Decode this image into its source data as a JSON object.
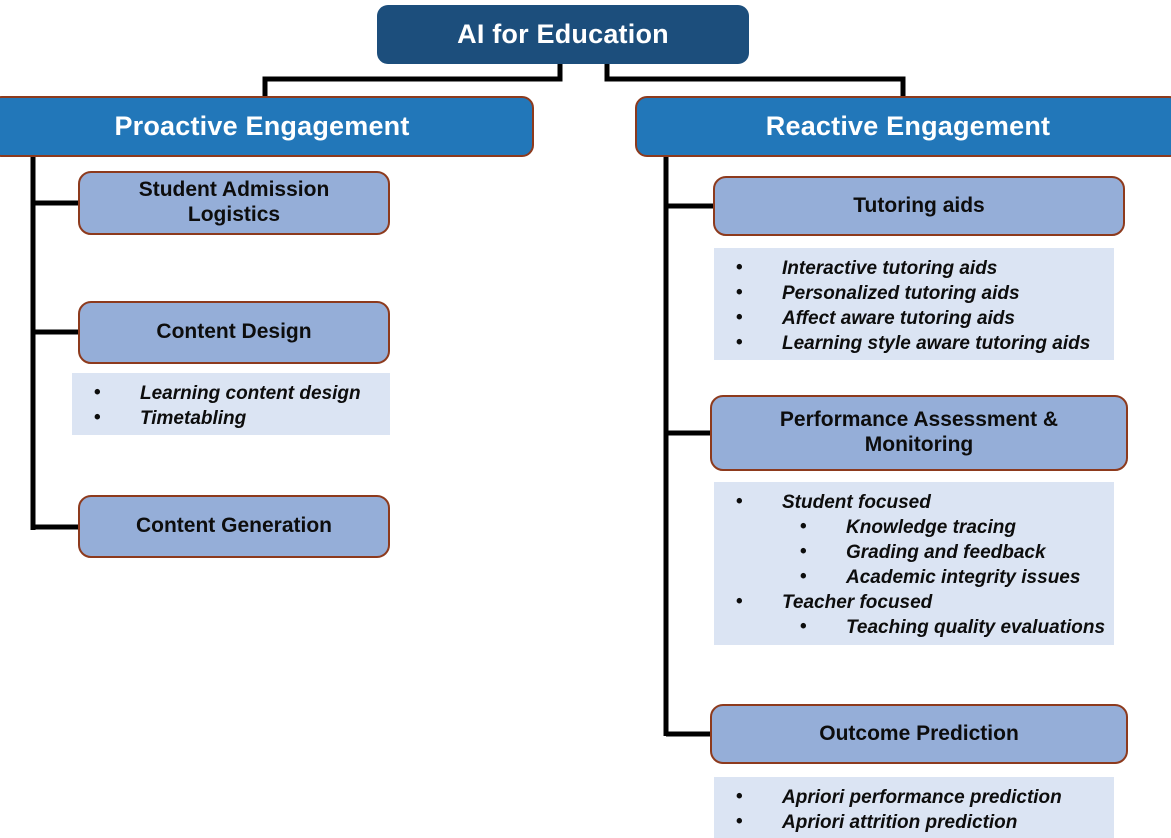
{
  "diagram": {
    "title": "AI for Education",
    "root": {
      "label": "AI for Education"
    },
    "branches": [
      {
        "id": "proactive",
        "label": "Proactive Engagement",
        "children": [
          {
            "id": "admission",
            "label": "Student Admission Logistics",
            "label_line1": "Student Admission",
            "label_line2": "Logistics",
            "bullets": []
          },
          {
            "id": "design",
            "label": "Content Design",
            "bullets": [
              {
                "level": 1,
                "text": "Learning content design"
              },
              {
                "level": 1,
                "text": "Timetabling"
              }
            ]
          },
          {
            "id": "generation",
            "label": "Content Generation",
            "bullets": []
          }
        ]
      },
      {
        "id": "reactive",
        "label": "Reactive Engagement",
        "children": [
          {
            "id": "tutoring",
            "label": "Tutoring aids",
            "bullets": [
              {
                "level": 1,
                "text": "Interactive tutoring aids"
              },
              {
                "level": 1,
                "text": "Personalized tutoring aids"
              },
              {
                "level": 1,
                "text": "Affect aware tutoring aids"
              },
              {
                "level": 1,
                "text": "Learning style aware tutoring aids"
              }
            ]
          },
          {
            "id": "performance",
            "label": "Performance Assessment & Monitoring",
            "label_line1": "Performance Assessment &",
            "label_line2": "Monitoring",
            "bullets": [
              {
                "level": 1,
                "text": "Student focused"
              },
              {
                "level": 2,
                "text": "Knowledge tracing"
              },
              {
                "level": 2,
                "text": "Grading and feedback"
              },
              {
                "level": 2,
                "text": "Academic integrity issues"
              },
              {
                "level": 1,
                "text": "Teacher focused"
              },
              {
                "level": 2,
                "text": "Teaching quality evaluations"
              }
            ]
          },
          {
            "id": "outcome",
            "label": "Outcome Prediction",
            "bullets": [
              {
                "level": 1,
                "text": "Apriori performance prediction"
              },
              {
                "level": 1,
                "text": "Apriori attrition prediction"
              }
            ]
          }
        ]
      }
    ],
    "colors": {
      "root_fill": "#1c4e7c",
      "level1_fill": "#2277b9",
      "level2_fill": "#95aed8",
      "box_border": "#8d3a1d",
      "panel_fill": "#dbe4f3",
      "connector": "#000000",
      "level1_text": "#ffffff",
      "level2_text": "#0d0d0d",
      "background": "#ffffff"
    }
  }
}
